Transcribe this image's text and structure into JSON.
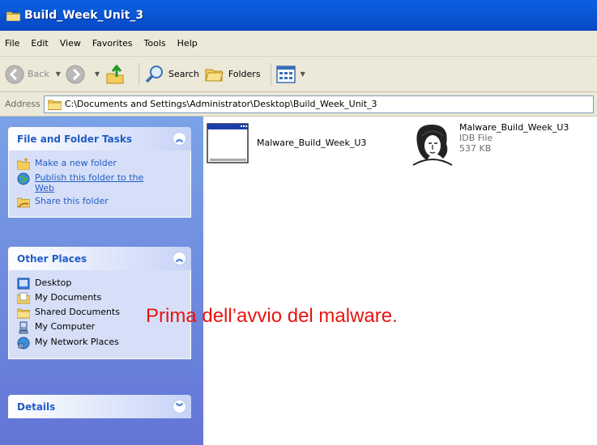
{
  "window": {
    "title": "Build_Week_Unit_3"
  },
  "menu": [
    "File",
    "Edit",
    "View",
    "Favorites",
    "Tools",
    "Help"
  ],
  "toolbar": {
    "back_label": "Back",
    "search_label": "Search",
    "folders_label": "Folders"
  },
  "address": {
    "label": "Address",
    "path": "C:\\Documents and Settings\\Administrator\\Desktop\\Build_Week_Unit_3"
  },
  "task_pane": {
    "file_tasks": {
      "title": "File and Folder Tasks",
      "items": [
        "Make a new folder",
        "Publish this folder to the Web",
        "Share this folder"
      ]
    },
    "other_places": {
      "title": "Other Places",
      "items": [
        "Desktop",
        "My Documents",
        "Shared Documents",
        "My Computer",
        "My Network Places"
      ]
    },
    "details": {
      "title": "Details"
    }
  },
  "files": [
    {
      "name": "Malware_Build_Week_U3",
      "icon": "application-window-icon"
    },
    {
      "name": "Malware_Build_Week_U3",
      "type": "IDB File",
      "size": "537 KB",
      "icon": "ida-portrait-icon"
    }
  ],
  "annotation": "Prima dell’avvio del malware.",
  "colors": {
    "title_bar": "#0a58d8",
    "task_pane": "#6f8de0",
    "link": "#215dc6",
    "annotation": "#e8140f"
  }
}
